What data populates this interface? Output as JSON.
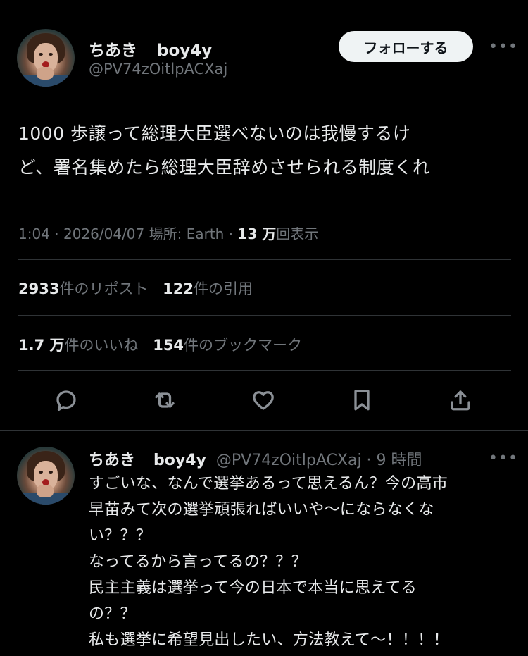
{
  "tweet": {
    "display_name": "ちあき",
    "display_name_suffix": "boy4y",
    "handle": "@PV74zOitlpACXaj",
    "follow_label": "フォローする",
    "more_label": "•••",
    "text_lines": [
      "1000 歩譲って総理大臣選べないのは我慢するけ",
      "ど、署名集めたら総理大臣辞めさせられる制度くれ"
    ],
    "meta_time": "1:04 · 2026/04/07 場所: Earth · ",
    "meta_views_count": "13 万",
    "meta_views_label": "回表示",
    "reposts_count": "2933",
    "reposts_label": "件のリポスト",
    "quotes_count": "122",
    "quotes_label": "件の引用",
    "likes_count": "1.7 万",
    "likes_label": "件のいいね",
    "bookmarks_count": "154",
    "bookmarks_label": "件のブックマーク"
  },
  "actions": {
    "icons": [
      "reply-icon",
      "retweet-icon",
      "like-icon",
      "bookmark-icon",
      "share-icon"
    ]
  },
  "reply": {
    "display_name": "ちあき",
    "display_name_suffix": "boy4y",
    "handle_time": "@PV74zOitlpACXaj · 9 時間",
    "more_label": "•••",
    "text_lines": [
      "すごいな、なんで選挙あるって思えるん？今の高市",
      "早苗みて次の選挙頑張ればいいや〜にならなくな",
      "い？？？",
      "なってるから言ってるの？？？",
      "民主主義は選挙って今の日本で本当に思えてる",
      "の？？",
      "私も選挙に希望見出したい、方法教えて〜！！！！"
    ]
  },
  "colors": {
    "background": "#000000",
    "text": "#e7e9ea",
    "secondary": "#71767b",
    "divider": "#2f3336",
    "follow_bg": "#eff3f4"
  }
}
